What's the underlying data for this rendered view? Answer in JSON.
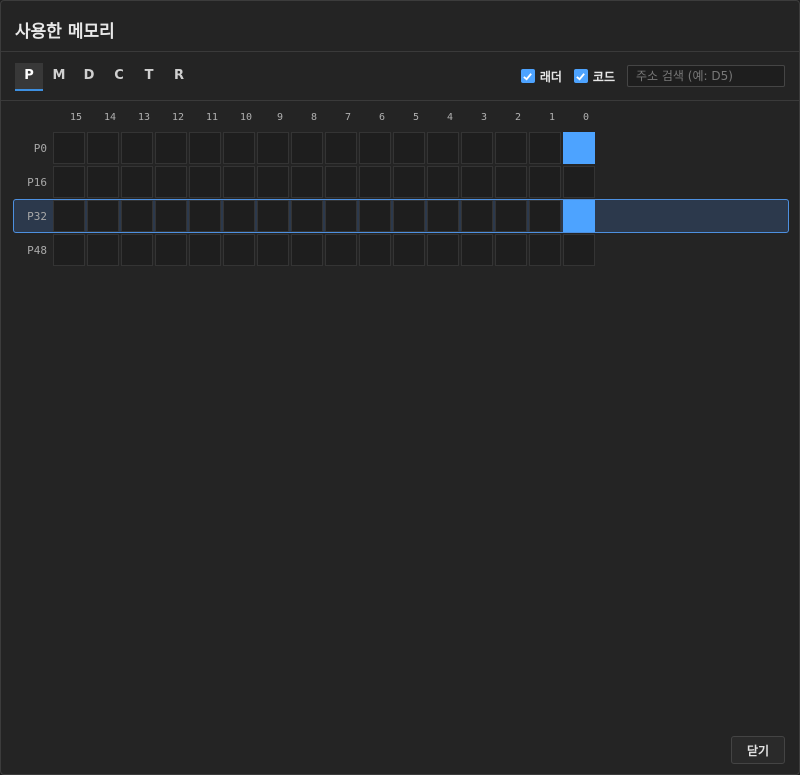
{
  "dialog": {
    "title": "사용한 메모리",
    "close_label": "닫기"
  },
  "tabs": [
    {
      "label": "P",
      "active": true
    },
    {
      "label": "M"
    },
    {
      "label": "D"
    },
    {
      "label": "C"
    },
    {
      "label": "T"
    },
    {
      "label": "R"
    }
  ],
  "filters": {
    "ladder": {
      "label": "래더",
      "checked": true
    },
    "code": {
      "label": "코드",
      "checked": true
    },
    "search_placeholder": "주소 검색 (예: D5)",
    "search_value": ""
  },
  "columns": [
    "15",
    "14",
    "13",
    "12",
    "11",
    "10",
    "9",
    "8",
    "7",
    "6",
    "5",
    "4",
    "3",
    "2",
    "1",
    "0"
  ],
  "rows": [
    {
      "label": "P0",
      "used_bits": [
        0
      ],
      "selected": false
    },
    {
      "label": "P16",
      "used_bits": [],
      "selected": false
    },
    {
      "label": "P32",
      "used_bits": [
        0
      ],
      "selected": true
    },
    {
      "label": "P48",
      "used_bits": [],
      "selected": false
    }
  ],
  "colors": {
    "accent": "#4da3ff",
    "selection": "#2c394c"
  }
}
